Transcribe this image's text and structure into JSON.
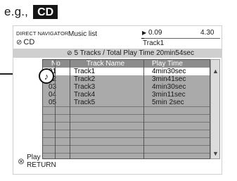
{
  "example": {
    "prefix": "e.g.,",
    "badge": "CD"
  },
  "header": {
    "navigator": "DIRECT NAVIGATOR",
    "disc": "CD",
    "music_list": "Music list",
    "current_time": "0.09",
    "total_time": "4.30",
    "progress": 0.035,
    "current_track": "Track1"
  },
  "summary": "5 Tracks / Total Play Time 20min54sec",
  "table": {
    "headers": {
      "no": "No",
      "name": "Track Name",
      "time": "Play Time"
    },
    "rows": [
      {
        "no": "01",
        "name": "Track1",
        "time": "4min30sec"
      },
      {
        "no": "02",
        "name": "Track2",
        "time": "3min41sec"
      },
      {
        "no": "03",
        "name": "Track3",
        "time": "4min30sec"
      },
      {
        "no": "04",
        "name": "Track4",
        "time": "3min11sec"
      },
      {
        "no": "05",
        "name": "Track5",
        "time": "5min 2sec"
      }
    ],
    "selected_index": 0
  },
  "playing_icon": "music-note-icon",
  "footer": {
    "play_label": "Play",
    "return_label": "RETURN"
  },
  "icons": {
    "disc": "disc-icon",
    "scroll_up": "scroll-up-icon",
    "scroll_down": "scroll-down-icon",
    "button": "remote-button-icon"
  },
  "colors": {
    "summary_bar": "#cfcfcf",
    "table_bg": "#aaaaaa",
    "table_header": "#8c8c8c",
    "selected_row": "#ffffff"
  }
}
